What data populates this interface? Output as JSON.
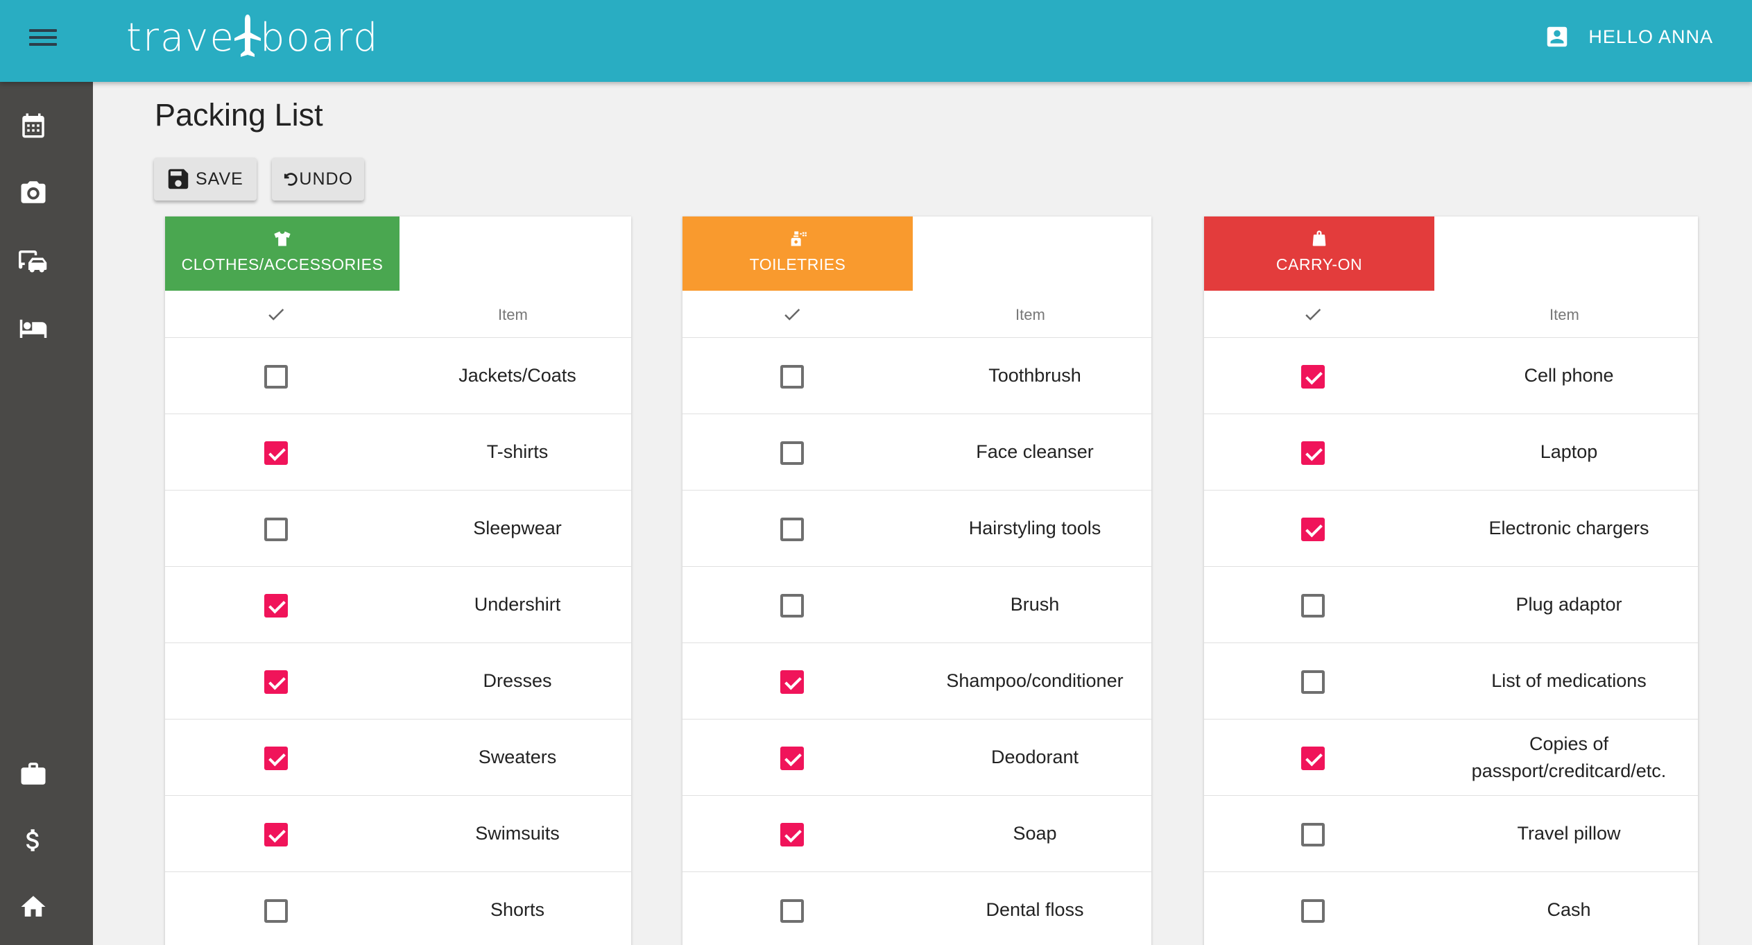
{
  "header": {
    "logo_left": "trave",
    "logo_right": "board",
    "user_label": "HELLO ANNA"
  },
  "page": {
    "title": "Packing List",
    "save_label": "SAVE",
    "undo_label": "UNDO"
  },
  "table": {
    "check_header_icon": "check-icon",
    "item_header": "Item"
  },
  "colors": {
    "appbar": "#29adc2",
    "sidebar": "#4a4947",
    "checked": "#f0145a",
    "clothes_tab": "#4aa750",
    "toiletries_tab": "#f99a2e",
    "carryon_tab": "#e33c3c"
  },
  "categories": [
    {
      "title": "CLOTHES/ACCESSORIES",
      "icon": "tshirt-icon",
      "items": [
        {
          "label": "Jackets/Coats",
          "checked": false
        },
        {
          "label": "T-shirts",
          "checked": true
        },
        {
          "label": "Sleepwear",
          "checked": false
        },
        {
          "label": "Undershirt",
          "checked": true
        },
        {
          "label": "Dresses",
          "checked": true
        },
        {
          "label": "Sweaters",
          "checked": true
        },
        {
          "label": "Swimsuits",
          "checked": true
        },
        {
          "label": "Shorts",
          "checked": false
        }
      ]
    },
    {
      "title": "TOILETRIES",
      "icon": "spray-bottle-icon",
      "items": [
        {
          "label": "Toothbrush",
          "checked": false
        },
        {
          "label": "Face cleanser",
          "checked": false
        },
        {
          "label": "Hairstyling tools",
          "checked": false
        },
        {
          "label": "Brush",
          "checked": false
        },
        {
          "label": "Shampoo/conditioner",
          "checked": true
        },
        {
          "label": "Deodorant",
          "checked": true
        },
        {
          "label": "Soap",
          "checked": true
        },
        {
          "label": "Dental floss",
          "checked": false
        }
      ]
    },
    {
      "title": "CARRY-ON",
      "icon": "bag-icon",
      "items": [
        {
          "label": "Cell phone",
          "checked": true
        },
        {
          "label": "Laptop",
          "checked": true
        },
        {
          "label": "Electronic chargers",
          "checked": true
        },
        {
          "label": "Plug adaptor",
          "checked": false
        },
        {
          "label": "List of medications",
          "checked": false
        },
        {
          "label": "Copies of\npassport/creditcard/etc.",
          "checked": true
        },
        {
          "label": "Travel pillow",
          "checked": false
        },
        {
          "label": "Cash",
          "checked": false
        }
      ]
    }
  ],
  "sidebar": {
    "items": [
      "calendar-icon",
      "camera-icon",
      "transport-icon",
      "hotel-bed-icon",
      "briefcase-icon",
      "dollar-icon",
      "home-icon"
    ]
  }
}
